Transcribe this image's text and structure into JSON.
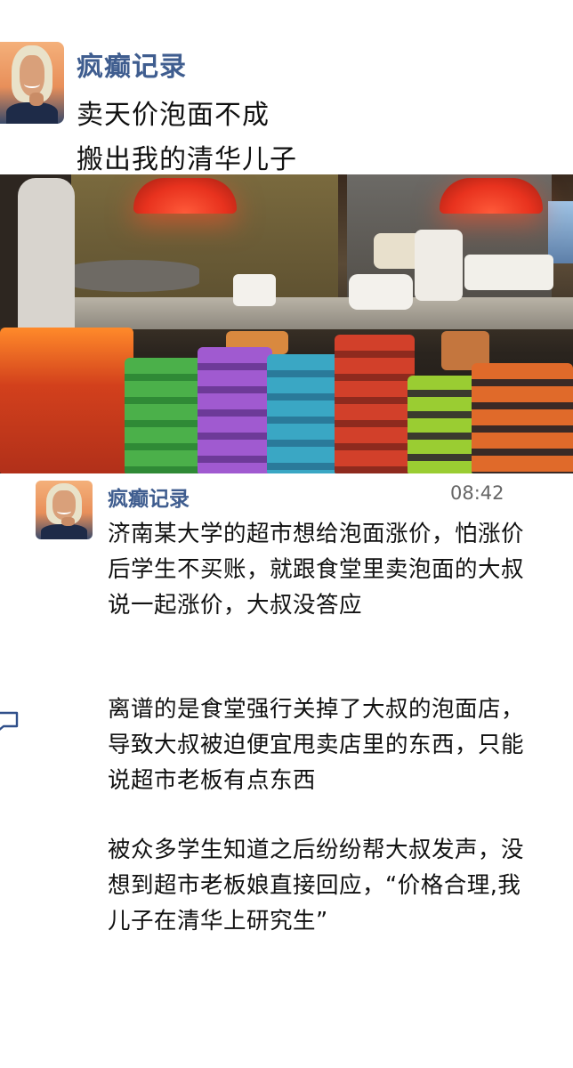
{
  "header": {
    "author": "疯癫记录",
    "headline_line1": "卖天价泡面不成",
    "headline_line2": "搬出我的清华儿子"
  },
  "post": {
    "author": "疯癫记录",
    "time": "08:42",
    "paragraphs": [
      "济南某大学的超市想给泡面涨价，怕涨价后学生不买账，就跟食堂里卖泡面的大叔说一起涨价，大叔没答应",
      "离谱的是食堂强行关掉了大叔的泡面店，导致大叔被迫便宜甩卖店里的东西，只能说超市老板有点东西",
      "被众多学生知道之后纷纷帮大叔发声，没想到超市老板娘直接回应，“价格合理,我儿子在清华上研究生”"
    ]
  },
  "icons": {
    "avatar": "avatar-icon",
    "comment": "comment-icon"
  },
  "colors": {
    "author_name": "#3f5d8f",
    "text": "#111111",
    "time": "#666666"
  }
}
